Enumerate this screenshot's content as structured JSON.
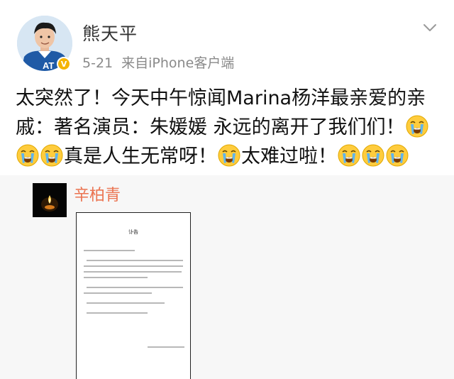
{
  "user": {
    "name": "熊天平",
    "date": "5-21",
    "source": "来自iPhone客户端",
    "verified_badge": "V"
  },
  "post": {
    "text_1": "太突然了！今天中午惊闻Marina杨洋最亲爱的亲戚：著名演员：朱媛媛 永远的离开了我们们！",
    "text_2": "真是人生无常呀！",
    "text_3": "太难过啦！"
  },
  "repost": {
    "author": "辛柏青",
    "document_title": "讣告"
  },
  "icons": {
    "menu": "chevron-down-icon",
    "emoji": "crying-face-emoji",
    "repost_avatar": "candle-icon"
  },
  "colors": {
    "repost_name": "#eb7350",
    "meta": "#8a8a8a",
    "badge": "#f5b400"
  }
}
